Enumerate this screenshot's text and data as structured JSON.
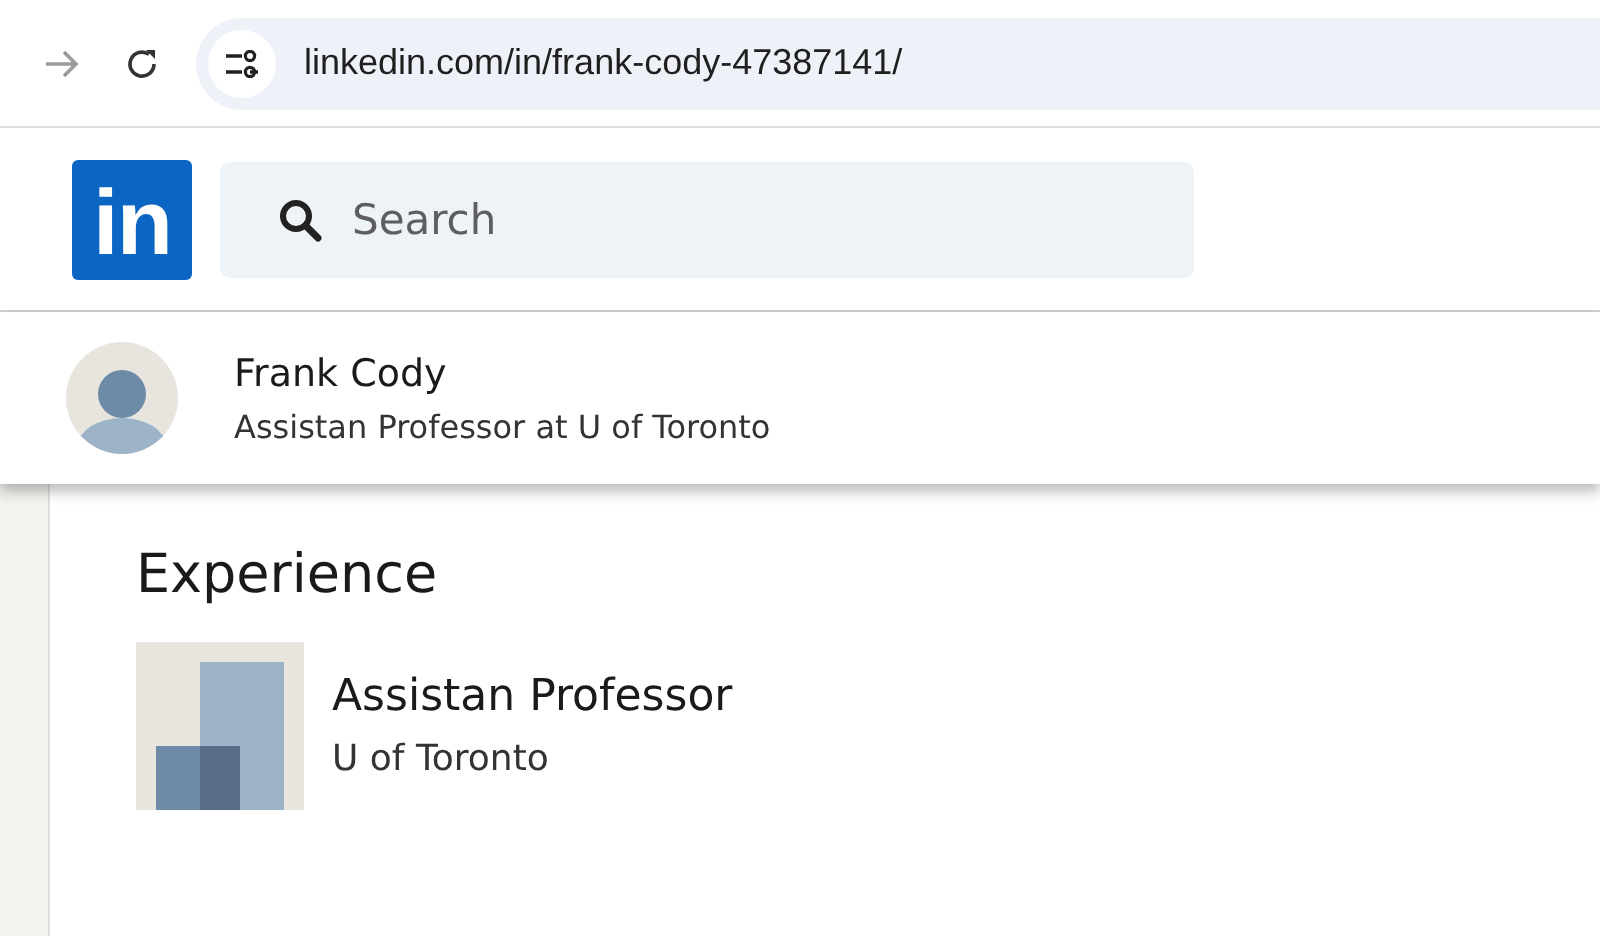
{
  "browser": {
    "url": "linkedin.com/in/frank-cody-47387141/"
  },
  "header": {
    "logo": "in",
    "search": {
      "placeholder": "Search"
    }
  },
  "profile_bar": {
    "name": "Frank Cody",
    "headline": "Assistan Professor at U of Toronto"
  },
  "experience": {
    "title": "Experience",
    "items": [
      {
        "title": "Assistan Professor",
        "company": "U of Toronto"
      }
    ]
  }
}
